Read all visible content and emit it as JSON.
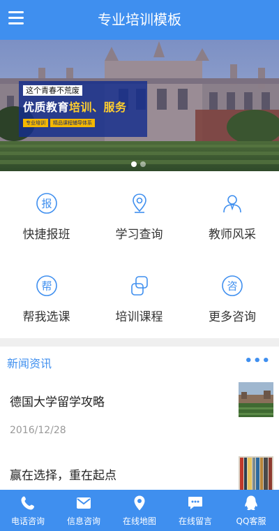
{
  "header": {
    "title": "专业培训模板",
    "menu_icon": "hamburger-menu-icon"
  },
  "banner": {
    "slogan_top": "这个青春不荒废",
    "slogan_main_prefix": "优质教育",
    "slogan_main_highlight": "培训、服务",
    "tags": [
      "专业培训",
      "精品课程辅导体系"
    ],
    "dots_count": 2,
    "active_dot": 1
  },
  "grid": [
    {
      "label": "快捷报班",
      "icon": "bao-char-icon",
      "glyph": "报"
    },
    {
      "label": "学习查询",
      "icon": "location-pin-icon"
    },
    {
      "label": "教师风采",
      "icon": "teacher-icon"
    },
    {
      "label": "帮我选课",
      "icon": "bang-char-icon",
      "glyph": "帮"
    },
    {
      "label": "培训课程",
      "icon": "course-icon"
    },
    {
      "label": "更多咨询",
      "icon": "zi-char-icon",
      "glyph": "咨"
    }
  ],
  "news": {
    "title": "新闻资讯",
    "more": "•••",
    "items": [
      {
        "title": "德国大学留学攻略",
        "date": "2016/12/28"
      },
      {
        "title": "赢在选择，重在起点",
        "date": ""
      }
    ]
  },
  "tabbar": [
    {
      "label": "电话咨询",
      "icon": "phone-icon"
    },
    {
      "label": "信息咨询",
      "icon": "mail-icon"
    },
    {
      "label": "在线地图",
      "icon": "map-pin-icon"
    },
    {
      "label": "在线留言",
      "icon": "chat-bubble-icon"
    },
    {
      "label": "QQ客服",
      "icon": "qq-icon"
    }
  ],
  "colors": {
    "primary": "#3f8fef",
    "highlight": "#ffce2e"
  }
}
